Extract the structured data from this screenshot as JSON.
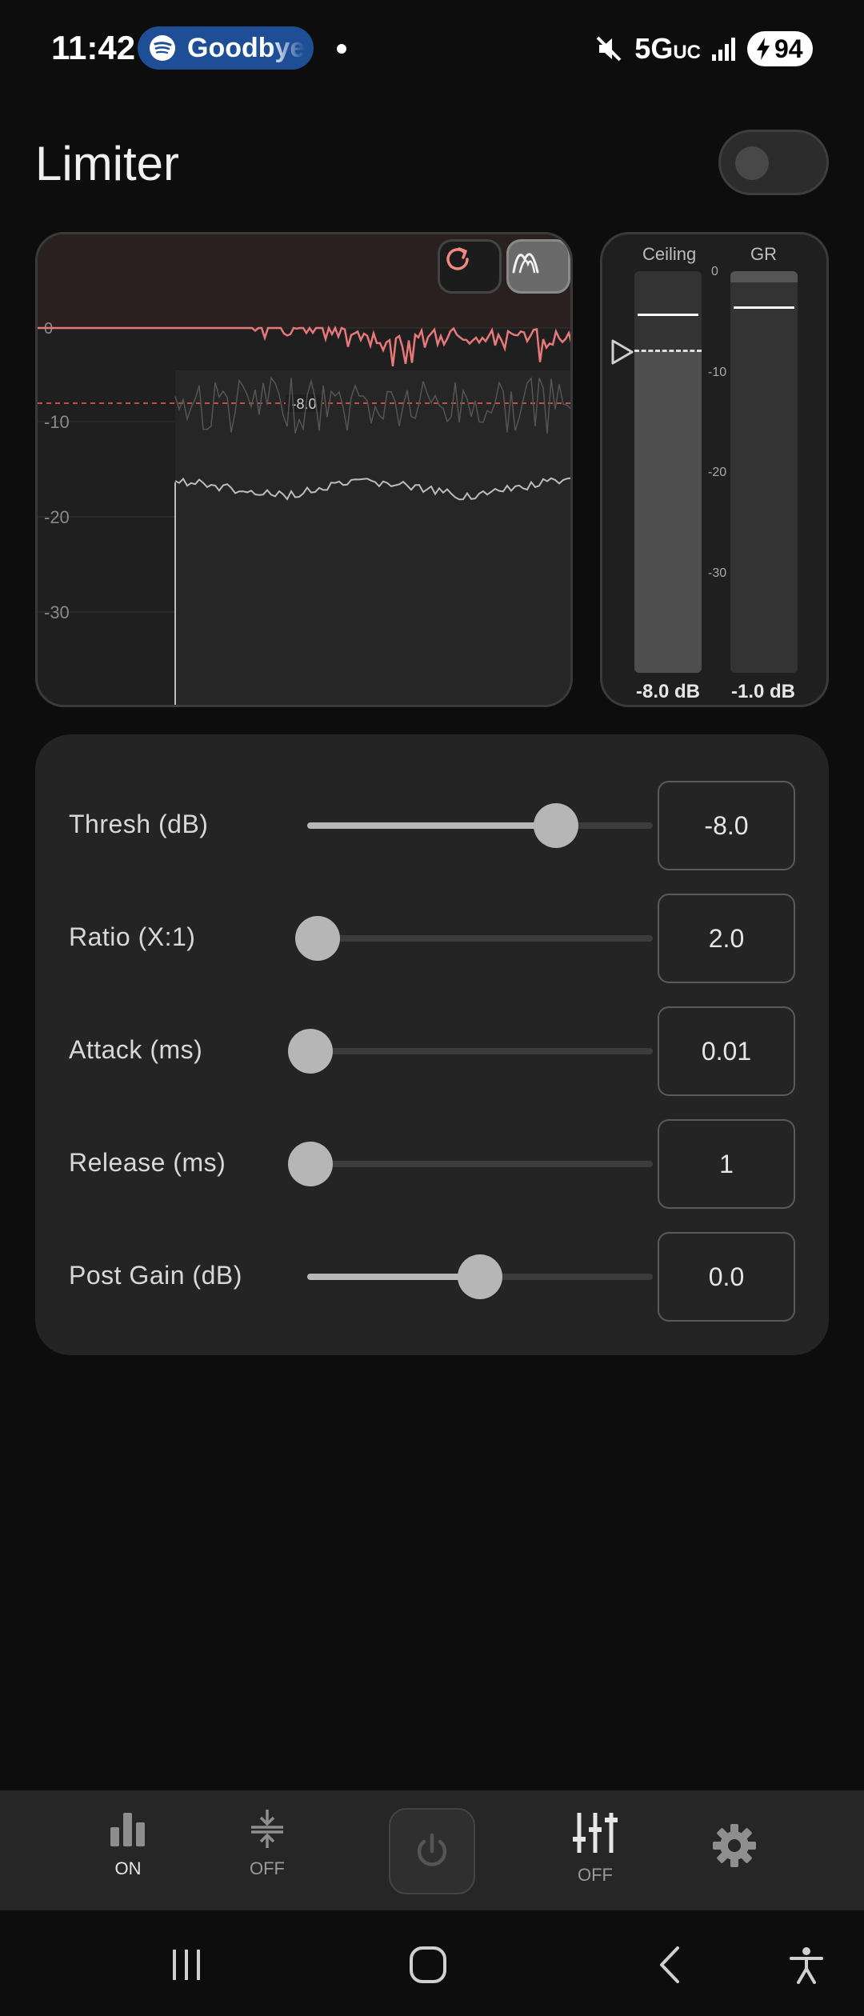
{
  "status_bar": {
    "time": "11:42",
    "media_title": "Goodbye",
    "network": "5G",
    "network_suffix": "UC",
    "battery": "94"
  },
  "header": {
    "title": "Limiter",
    "master_enabled": false
  },
  "graph": {
    "axis_labels": [
      "0",
      "-10",
      "-20",
      "-30"
    ],
    "threshold_label": "-8.0",
    "colors": {
      "gain_reduction": "#e8787a",
      "threshold_line": "#c05050",
      "level": "#bdbdbd"
    }
  },
  "meters": {
    "ceiling_label": "Ceiling",
    "gr_label": "GR",
    "ceiling_value": "-8.0 dB",
    "gr_value": "-1.0 dB",
    "scale_ticks": [
      "0",
      "-10",
      "-20",
      "-30"
    ]
  },
  "params": [
    {
      "label": "Thresh (dB)",
      "value": "-8.0",
      "fraction": 0.72,
      "show_fill": true
    },
    {
      "label": "Ratio (X:1)",
      "value": "2.0",
      "fraction": 0.03,
      "show_fill": false
    },
    {
      "label": "Attack (ms)",
      "value": "0.01",
      "fraction": 0.01,
      "show_fill": false
    },
    {
      "label": "Release (ms)",
      "value": "1",
      "fraction": 0.01,
      "show_fill": false
    },
    {
      "label": "Post Gain (dB)",
      "value": "0.0",
      "fraction": 0.5,
      "show_fill": true
    }
  ],
  "bottom_nav": {
    "eq_label": "ON",
    "compressor_label": "OFF",
    "mixer_label": "OFF"
  }
}
